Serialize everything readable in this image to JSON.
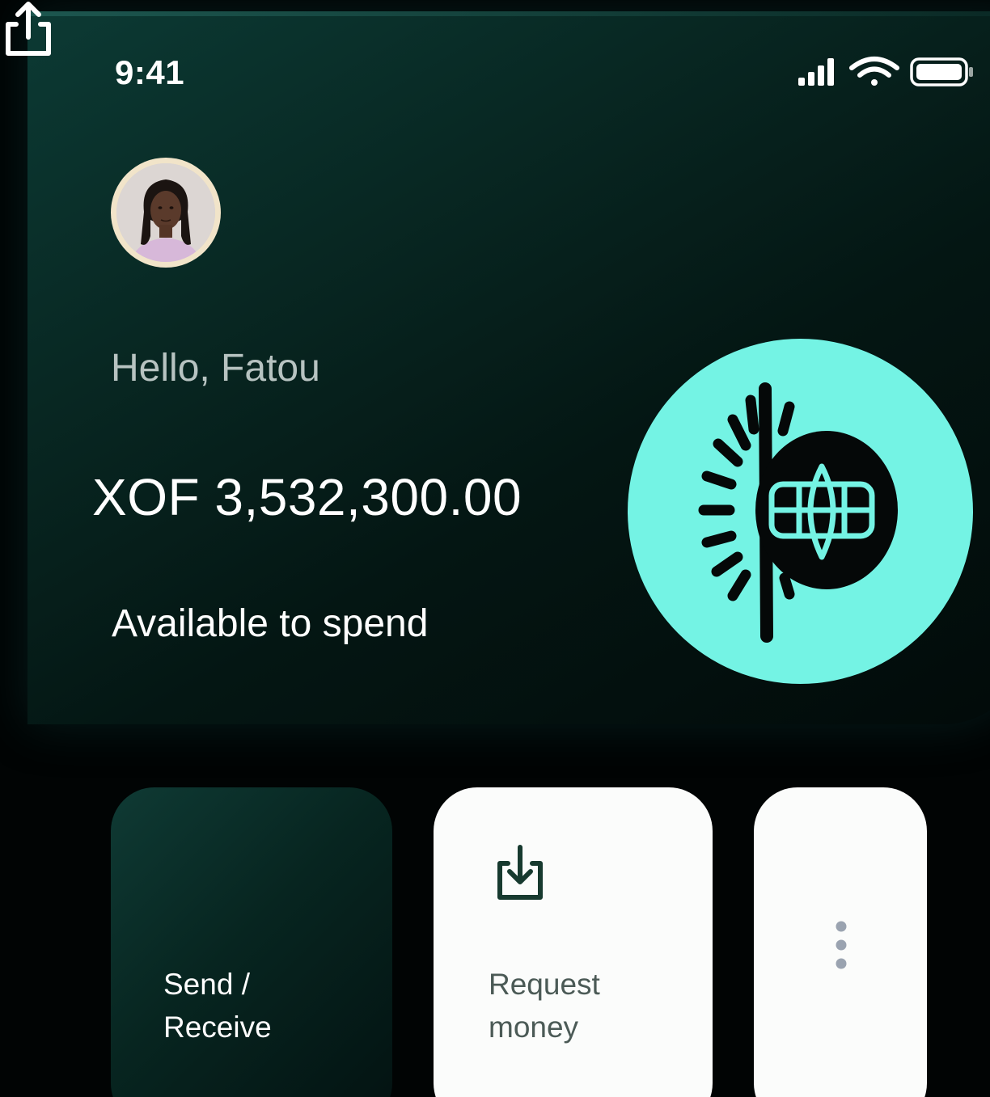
{
  "status_bar": {
    "time": "9:41",
    "icons": [
      "cellular-signal-icon",
      "wifi-icon",
      "battery-icon"
    ]
  },
  "header": {
    "avatar_icon": "user-avatar",
    "greeting": "Hello, Fatou"
  },
  "balance": {
    "amount": "XOF 3,532,300.00",
    "caption": "Available to spend"
  },
  "brand": {
    "logo_icon": "card-chip-logo-icon",
    "accent_color": "#74f3e4"
  },
  "actions": [
    {
      "label": "Send /\nReceive",
      "icon": "share-upload-icon",
      "style": "dark"
    },
    {
      "label": "Request\nmoney",
      "icon": "download-tray-icon",
      "style": "light"
    },
    {
      "label": "",
      "icon": "more-vertical-icon",
      "style": "light"
    }
  ],
  "colors": {
    "background": "#010404",
    "hero_gradient_start": "#0c3a34",
    "text_primary": "#ffffff",
    "text_muted": "#b7c3c1",
    "light_card": "#fbfcfb"
  }
}
